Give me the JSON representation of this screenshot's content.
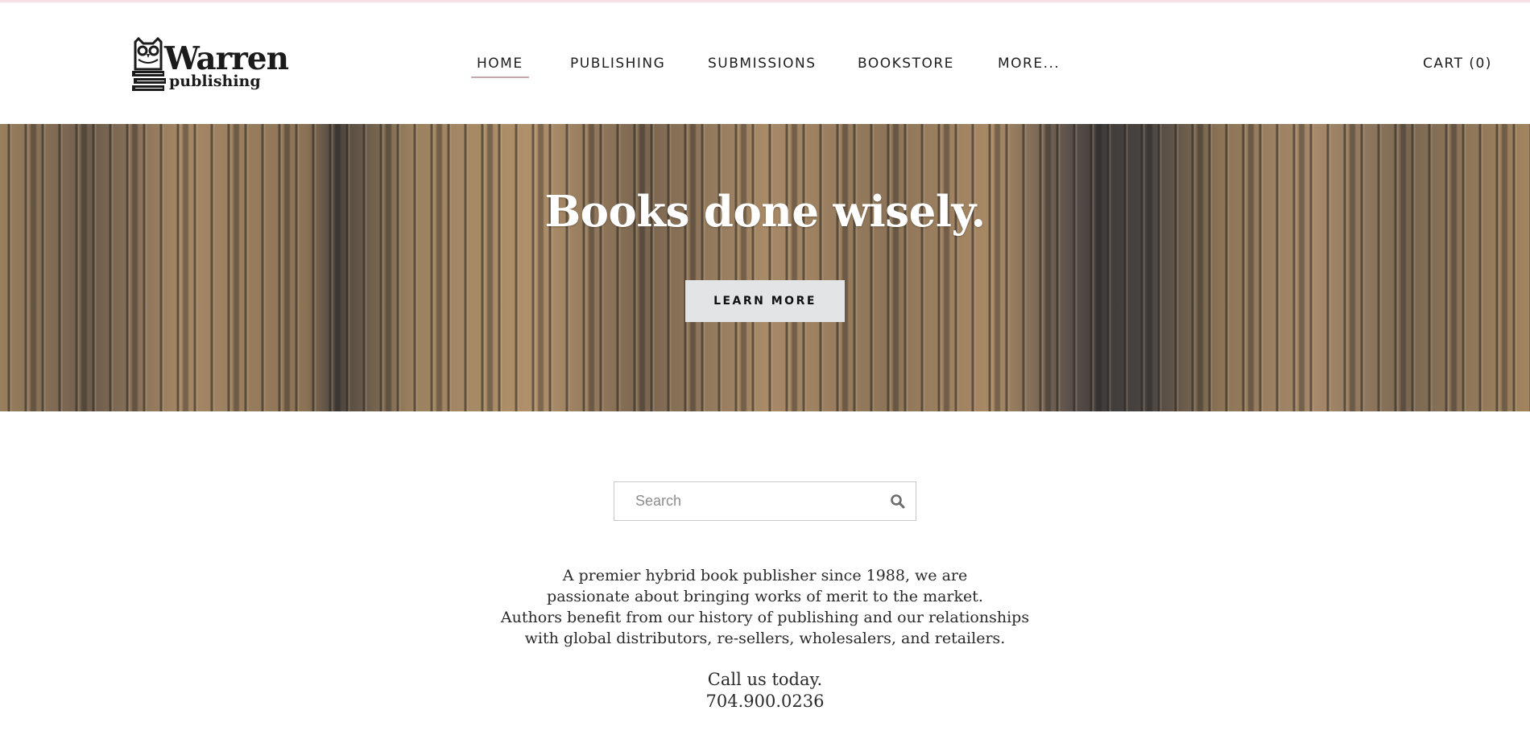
{
  "brand": {
    "logo_word": "Warren",
    "logo_sub": "publishing"
  },
  "nav": {
    "items": [
      {
        "label": "HOME",
        "active": true
      },
      {
        "label": "PUBLISHING",
        "active": false
      },
      {
        "label": "SUBMISSIONS",
        "active": false
      },
      {
        "label": "BOOKSTORE",
        "active": false
      },
      {
        "label": "MORE...",
        "active": false
      }
    ],
    "cart_label": "CART (0)"
  },
  "hero": {
    "title": "Books done wisely.",
    "button_label": "LEARN MORE"
  },
  "search": {
    "placeholder": "Search",
    "value": ""
  },
  "intro": {
    "lines": [
      "A premier hybrid book publisher since 1988, we are",
      "passionate about bringing works of merit to the market.",
      "Authors benefit from our history of publishing and our relationships",
      "with global distributors, re-sellers, wholesalers, and retailers."
    ]
  },
  "contact": {
    "call_text": "Call us today.",
    "phone": "704.900.0236"
  },
  "colors": {
    "accent_underline": "#c9a7ad",
    "button_bg": "#e3e4e6",
    "top_strip": "#f7e1e4"
  }
}
